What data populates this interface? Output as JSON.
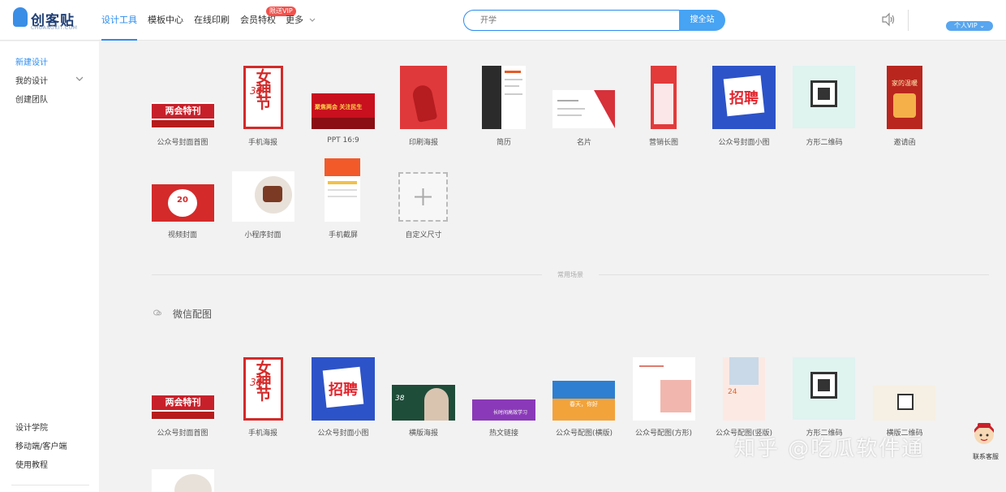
{
  "logo": {
    "brand": "创客贴",
    "sub": "CHUANGKIT.COM"
  },
  "nav": [
    {
      "label": "设计工具",
      "active": true
    },
    {
      "label": "模板中心"
    },
    {
      "label": "在线印刷"
    },
    {
      "label": "会员特权"
    },
    {
      "label": "更多"
    }
  ],
  "nav_badge": "限送VIP",
  "search": {
    "placeholder": "开学",
    "button": "搜全站"
  },
  "user": {
    "vip_label": "个人VIP"
  },
  "sidebar": {
    "top": [
      "新建设计",
      "我的设计",
      "创建团队"
    ],
    "bottom": [
      "设计学院",
      "移动端/客户端",
      "使用教程"
    ]
  },
  "tools": [
    "公众号封面首图",
    "手机海报",
    "PPT 16:9",
    "印刷海报",
    "简历",
    "名片",
    "营销长图",
    "公众号封面小图",
    "方形二维码",
    "邀请函",
    "视频封面",
    "小程序封面",
    "手机截屏",
    "自定义尺寸"
  ],
  "divider_text": "常用场景",
  "section": {
    "title": "微信配图"
  },
  "wechat": [
    "公众号封面首图",
    "手机海报",
    "公众号封面小图",
    "横版海报",
    "热文链接",
    "公众号配图(横版)",
    "公众号配图(方形)",
    "公众号配图(竖版)",
    "方形二维码",
    "横版二维码"
  ],
  "thumb_text": {
    "banner": "两会特刊",
    "goddess": "女神节",
    "goddess_num": "38",
    "ppt": "聚焦两会 关注民生",
    "recruit": "招聘",
    "video": "20",
    "invite": "家的温暖",
    "spring": "春天，你好",
    "hotlink": "长时间高效学习",
    "vertical": "24"
  },
  "watermark": "知乎 @吃瓜软件通",
  "cs_label": "联系客服",
  "colors": {
    "accent": "#2a8cf0",
    "red": "#d42a2a"
  }
}
